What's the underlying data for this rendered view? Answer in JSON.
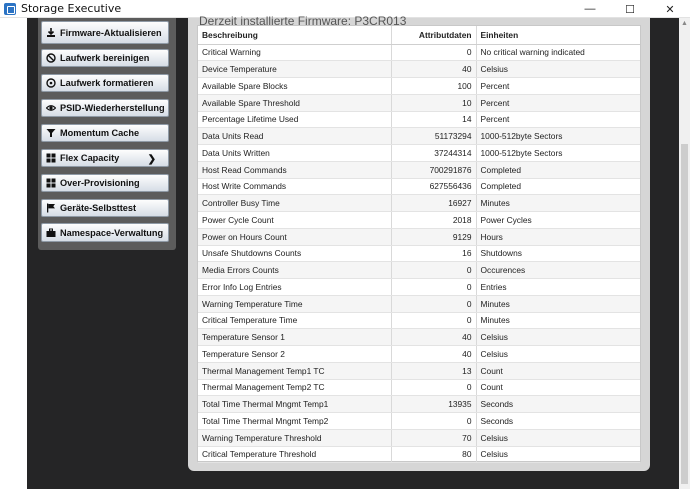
{
  "window": {
    "title": "Storage Executive",
    "minimize": "—",
    "maximize": "☐",
    "close": "✕"
  },
  "header": {
    "firmware_text": "Derzeit installierte Firmware: P3CR013"
  },
  "sidebar": {
    "items": [
      {
        "label": "Firmware-Aktualisieren",
        "icon": "download-icon"
      },
      {
        "label": "Laufwerk bereinigen",
        "icon": "no-entry-icon"
      },
      {
        "label": "Laufwerk formatieren",
        "icon": "disk-icon"
      },
      {
        "label": "PSID-Wiederherstellung",
        "icon": "eye-icon"
      },
      {
        "label": "Momentum Cache",
        "icon": "filter-icon"
      },
      {
        "label": "Flex Capacity",
        "icon": "grid-icon",
        "arrow": "❯"
      },
      {
        "label": "Over-Provisioning",
        "icon": "grid-icon"
      },
      {
        "label": "Geräte-Selbsttest",
        "icon": "flag-icon"
      },
      {
        "label": "Namespace-Verwaltung",
        "icon": "folder-icon"
      }
    ]
  },
  "table": {
    "headers": [
      "Beschreibung",
      "Attributdaten",
      "Einheiten"
    ],
    "rows": [
      [
        "Critical Warning",
        "0",
        "No critical warning indicated"
      ],
      [
        "Device Temperature",
        "40",
        "Celsius"
      ],
      [
        "Available Spare Blocks",
        "100",
        "Percent"
      ],
      [
        "Available Spare Threshold",
        "10",
        "Percent"
      ],
      [
        "Percentage Lifetime Used",
        "14",
        "Percent"
      ],
      [
        "Data Units Read",
        "51173294",
        "1000-512byte Sectors"
      ],
      [
        "Data Units Written",
        "37244314",
        "1000-512byte Sectors"
      ],
      [
        "Host Read Commands",
        "700291876",
        "Completed"
      ],
      [
        "Host Write Commands",
        "627556436",
        "Completed"
      ],
      [
        "Controller Busy Time",
        "16927",
        "Minutes"
      ],
      [
        "Power Cycle Count",
        "2018",
        "Power Cycles"
      ],
      [
        "Power on Hours Count",
        "9129",
        "Hours"
      ],
      [
        "Unsafe Shutdowns Counts",
        "16",
        "Shutdowns"
      ],
      [
        "Media Errors Counts",
        "0",
        "Occurences"
      ],
      [
        "Error Info Log Entries",
        "0",
        "Entries"
      ],
      [
        "Warning Temperature Time",
        "0",
        "Minutes"
      ],
      [
        "Critical Temperature Time",
        "0",
        "Minutes"
      ],
      [
        "Temperature Sensor 1",
        "40",
        "Celsius"
      ],
      [
        "Temperature Sensor 2",
        "40",
        "Celsius"
      ],
      [
        "Thermal Management Temp1 TC",
        "13",
        "Count"
      ],
      [
        "Thermal Management Temp2 TC",
        "0",
        "Count"
      ],
      [
        "Total Time Thermal Mngmt Temp1",
        "13935",
        "Seconds"
      ],
      [
        "Total Time Thermal Mngmt Temp2",
        "0",
        "Seconds"
      ],
      [
        "Warning Temperature Threshold",
        "70",
        "Celsius"
      ],
      [
        "Critical Temperature Threshold",
        "80",
        "Celsius"
      ]
    ]
  },
  "colors": {
    "app_background": "#252526",
    "sidebar_panel": "#5c5c5c",
    "content_panel": "#d6d6d6",
    "accent": "#2b73c4"
  }
}
